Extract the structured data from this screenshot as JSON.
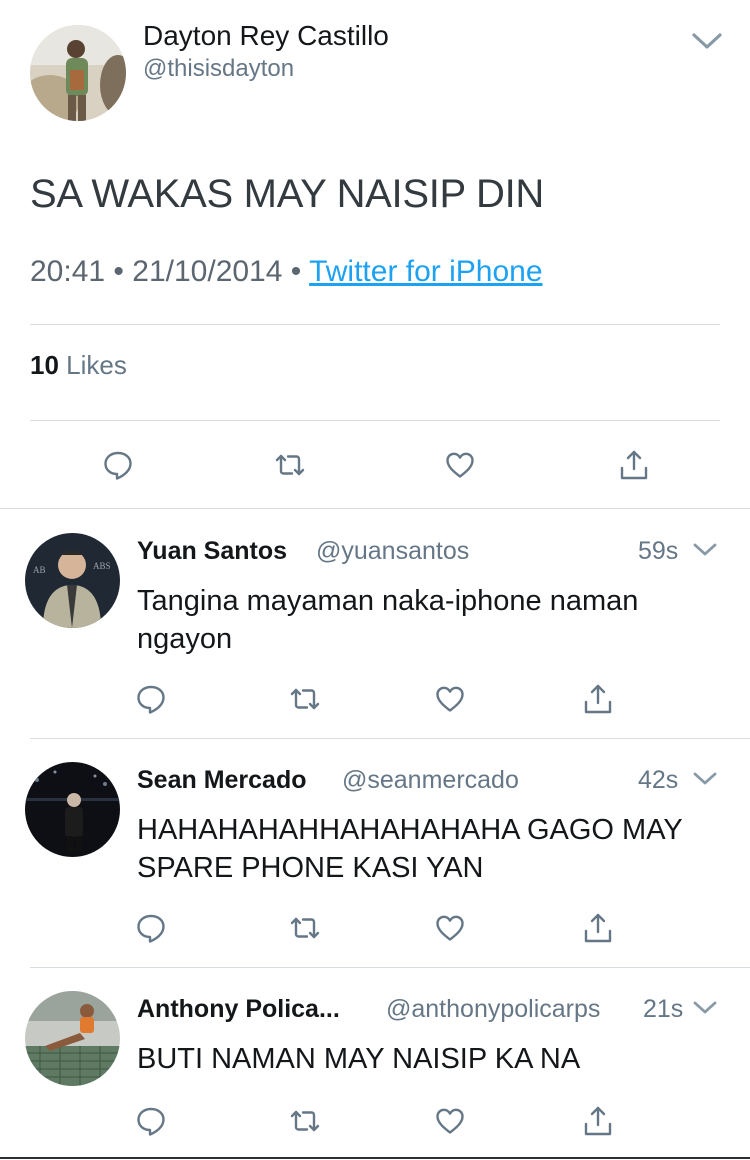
{
  "main_tweet": {
    "author_name": "Dayton Rey Castillo",
    "author_handle": "@thisisdayton",
    "text": "SA WAKAS MAY NAISIP DIN",
    "time": "20:41",
    "date": "21/10/2014",
    "source": "Twitter for iPhone",
    "likes_count": "10",
    "likes_label": "Likes"
  },
  "replies": [
    {
      "name": "Yuan Santos",
      "handle": "@yuansantos",
      "time": "59s",
      "text": "Tangina mayaman naka-iphone naman ngayon"
    },
    {
      "name": "Sean Mercado",
      "handle": "@seanmercado",
      "time": "42s",
      "text": "HAHAHAHAHHAHAHAHAHA GAGO MAY SPARE PHONE KASI YAN"
    },
    {
      "name": "Anthony Polica...",
      "handle": "@anthonypolicarps",
      "time": "21s",
      "text": "BUTI NAMAN MAY NAISIP KA NA"
    }
  ],
  "separator": "•",
  "icons": [
    "chevron-down-icon",
    "reply-icon",
    "retweet-icon",
    "like-icon",
    "share-icon"
  ],
  "colors": {
    "link": "#1da1f2",
    "secondary": "#657786",
    "divider": "#d8dde1"
  }
}
